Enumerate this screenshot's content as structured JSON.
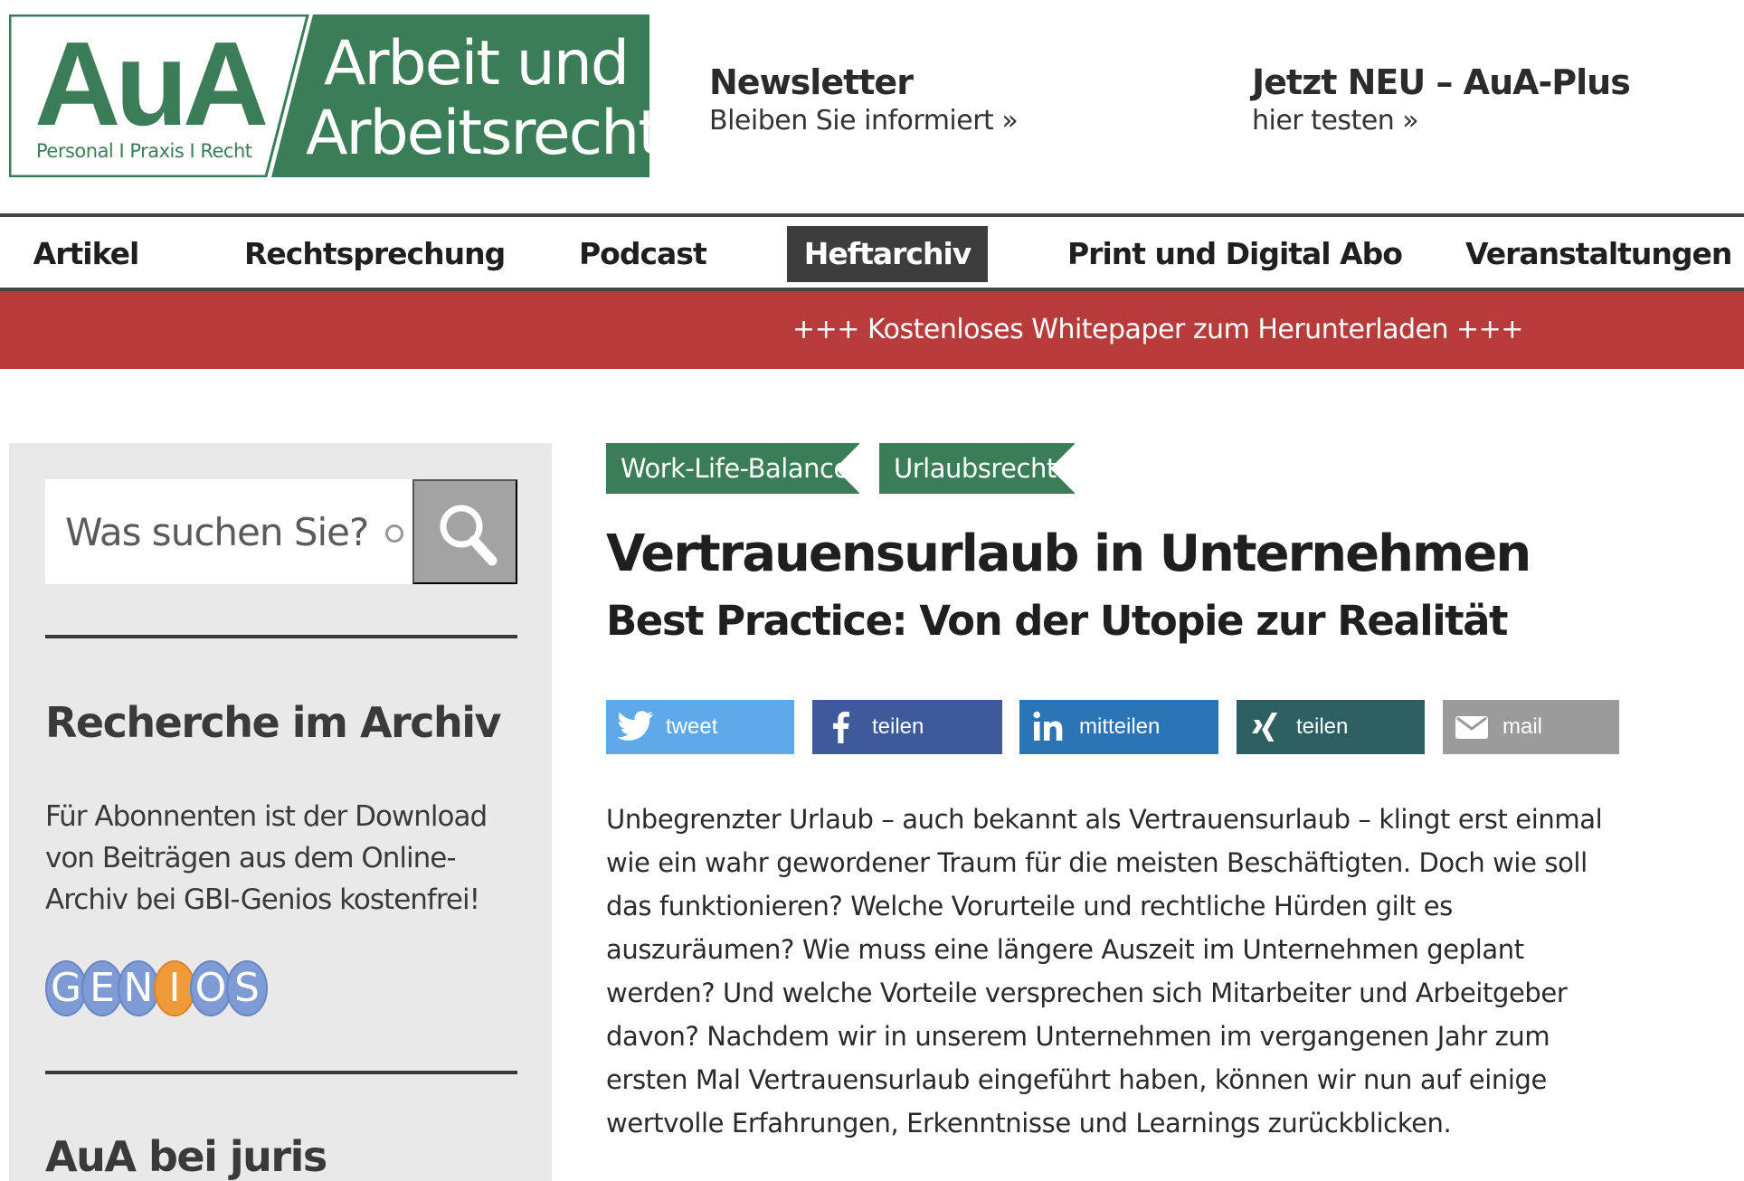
{
  "header": {
    "logo": {
      "short": "AuA",
      "tagline": "Personal I Praxis I Recht",
      "line1": "Arbeit und",
      "line2": "Arbeitsrecht",
      "green": "#3a7d57"
    },
    "newsletter": {
      "title": "Newsletter",
      "subtitle": "Bleiben Sie informiert »"
    },
    "aua_plus": {
      "title": "Jetzt NEU – AuA-Plus",
      "subtitle": "hier testen »"
    }
  },
  "nav": {
    "items": [
      {
        "label": "Artikel"
      },
      {
        "label": "Rechtsprechung"
      },
      {
        "label": "Podcast"
      },
      {
        "label": "Heftarchiv",
        "active": true
      },
      {
        "label": "Print und Digital Abo"
      },
      {
        "label": "Veranstaltungen"
      }
    ]
  },
  "banner": {
    "text": "+++ Kostenloses Whitepaper zum Herunterladen +++",
    "color": "#b73b3b"
  },
  "sidebar": {
    "search": {
      "placeholder": "Was suchen Sie?",
      "button_icon": "search-icon"
    },
    "archive": {
      "heading": "Recherche im Archiv",
      "text": "Für Abonnenten ist der Download von Beiträgen aus dem Online-Archiv bei GBI-Genios kostenfrei!",
      "genios_letters": [
        "G",
        "E",
        "N",
        "I",
        "O",
        "S"
      ]
    },
    "juris": {
      "heading": "AuA bei juris"
    }
  },
  "article": {
    "tags": [
      "Work-Life-Balance",
      "Urlaubsrecht"
    ],
    "title": "Vertrauensurlaub in Unternehmen",
    "subtitle": "Best Practice: Von der Utopie zur Realität",
    "share": {
      "twitter": "tweet",
      "facebook": "teilen",
      "linkedin": "mitteilen",
      "xing": "teilen",
      "mail": "mail"
    },
    "lead": "Unbegrenzter Urlaub – auch bekannt als Vertrauensurlaub – klingt erst einmal wie ein wahr gewordener Traum für die meisten Beschäftigten. Doch wie soll das funktionieren? Welche Vorurteile und rechtliche Hürden gilt es auszuräumen? Wie muss eine längere Auszeit im Unternehmen geplant werden? Und welche Vorteile versprechen sich Mitarbeiter und Arbeitgeber davon? Nachdem wir in unserem Unternehmen im vergangenen Jahr zum ersten Mal Vertrauensurlaub eingeführt haben, können wir nun auf einige wertvolle Erfahrungen, Erkenntnisse und Learnings zurückblicken."
  }
}
